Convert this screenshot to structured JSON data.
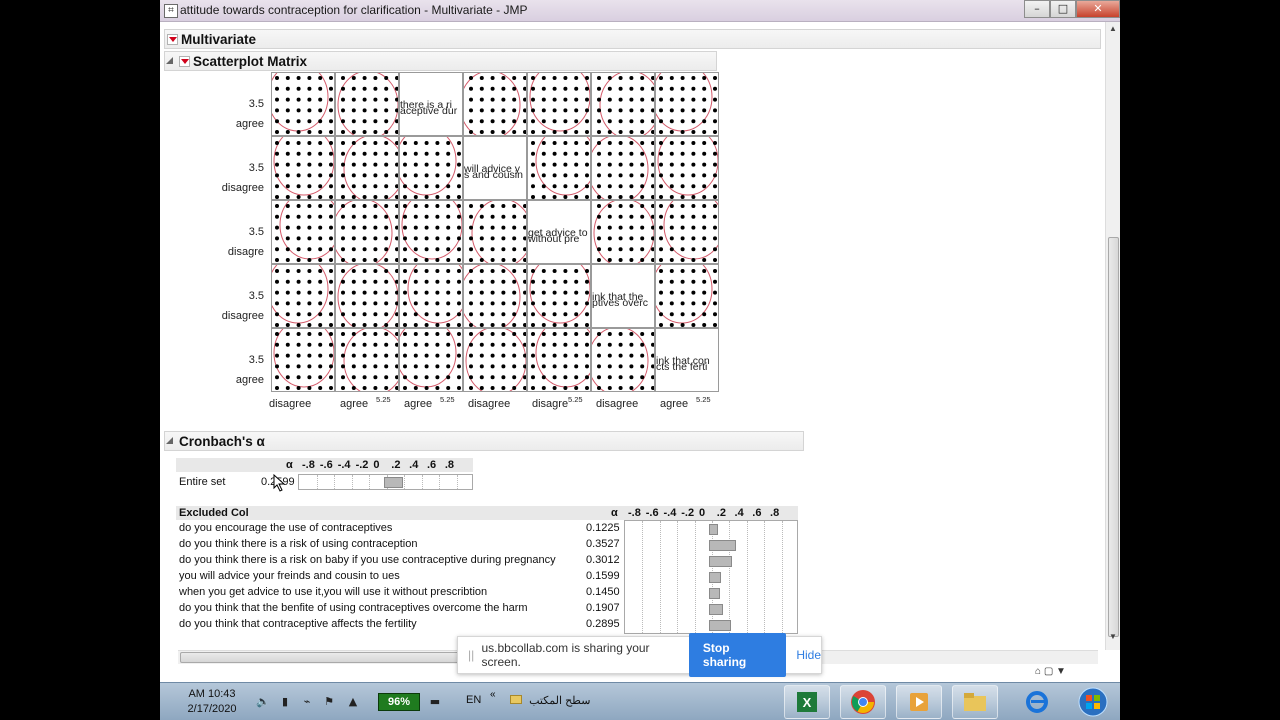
{
  "window": {
    "title": "attitude towards contraception for clarification - Multivariate - JMP"
  },
  "sections": {
    "multivariate": "Multivariate",
    "scatterplot": "Scatterplot Matrix",
    "cronbach": "Cronbach's α"
  },
  "matrix": {
    "row_labels": [
      "agree",
      "disagree",
      "disagre",
      "disagree",
      "agree"
    ],
    "row_ticks": [
      "3.5",
      "3.5",
      "3.5",
      "3.5",
      "3.5"
    ],
    "col_labels": [
      "disagree",
      "agree",
      "agree",
      "disagree",
      "disagre",
      "disagree",
      "agree"
    ],
    "col_small": [
      "5.25",
      "5.25",
      "5.25",
      "5.25"
    ],
    "diagonal": [
      [
        "there is a ri",
        "aceptive dur"
      ],
      [
        "will advice y",
        "s and cousin"
      ],
      [
        "get advice to",
        "without pre"
      ],
      [
        "ink that the",
        "ptives overc"
      ],
      [
        "ink that con",
        "cts the ferti"
      ]
    ]
  },
  "cronbach_entire": {
    "alpha_header": "α",
    "axis_ticks": [
      "-.8",
      "-.6",
      "-.4",
      "-.2",
      "0",
      ".2",
      ".4",
      ".6",
      ".8"
    ],
    "label": "Entire set",
    "value": "0.2599",
    "alpha": 0.2599
  },
  "excluded": {
    "header": "Excluded Col",
    "alpha_header": "α",
    "axis_ticks": [
      "-.8",
      "-.6",
      "-.4",
      "-.2",
      "0",
      ".2",
      ".4",
      ".6",
      ".8"
    ],
    "rows": [
      {
        "label": "do you encourage the use of contraceptives",
        "value": "0.1225",
        "alpha": 0.1225
      },
      {
        "label": "do you think there is a risk of using contraception",
        "value": "0.3527",
        "alpha": 0.3527
      },
      {
        "label": "do you think there is a risk on baby if you use contraceptive during pregnancy",
        "value": "0.3012",
        "alpha": 0.3012
      },
      {
        "label": "you will advice your freinds and cousin to ues",
        "value": "0.1599",
        "alpha": 0.1599
      },
      {
        "label": "when you get advice to use it,you will use it without prescribtion",
        "value": "0.1450",
        "alpha": 0.145
      },
      {
        "label": "do you think that the benfite of using contraceptives overcome the harm",
        "value": "0.1907",
        "alpha": 0.1907
      },
      {
        "label": "do you think that contraceptive affects the fertility",
        "value": "0.2895",
        "alpha": 0.2895
      }
    ]
  },
  "share_banner": {
    "message": "us.bbcollab.com is sharing your screen.",
    "stop": "Stop sharing",
    "hide": "Hide"
  },
  "taskbar": {
    "time": "AM 10:43",
    "date": "2/17/2020",
    "battery": "96%",
    "lang": "EN",
    "desktop": "سطح المكتب"
  }
}
